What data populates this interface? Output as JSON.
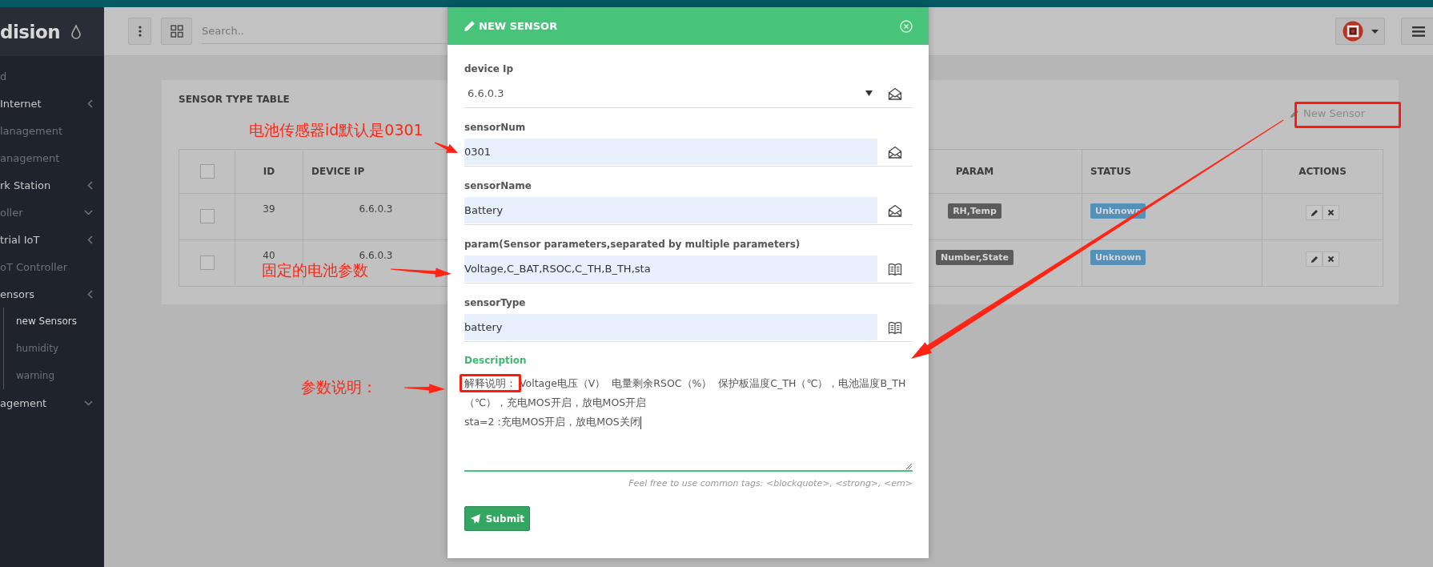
{
  "sidebar": {
    "brand": "dision",
    "items": [
      {
        "label": "d",
        "kind": "link"
      },
      {
        "label": "Internet",
        "kind": "heading",
        "expanded": false
      },
      {
        "label": "lanagement",
        "kind": "link"
      },
      {
        "label": "anagement",
        "kind": "link"
      },
      {
        "label": "rk Station",
        "kind": "heading",
        "expanded": false
      },
      {
        "label": "oller",
        "kind": "link",
        "expanded": true
      },
      {
        "label": "trial IoT",
        "kind": "heading",
        "expanded": false
      },
      {
        "label": "oT Controller",
        "kind": "link"
      },
      {
        "label": "ensors",
        "kind": "heading",
        "expanded": false,
        "children": [
          {
            "label": "new Sensors",
            "selected": true
          },
          {
            "label": "humidity",
            "selected": false
          },
          {
            "label": "warning",
            "selected": false
          }
        ]
      },
      {
        "label": "agement",
        "kind": "heading",
        "expanded": true
      }
    ]
  },
  "header": {
    "search": {
      "placeholder": "Search.."
    }
  },
  "panel": {
    "title": "SENSOR TYPE TABLE",
    "new_button": "New Sensor",
    "table": {
      "columns": [
        "ID",
        "DEVICE IP",
        "PARAM",
        "STATUS",
        "ACTIONS"
      ],
      "select_all_checked": false,
      "rows": [
        {
          "checked": false,
          "id": "39",
          "device_ip": "6.6.0.3",
          "param": "RH,Temp",
          "status": "Unknown"
        },
        {
          "checked": false,
          "id": "40",
          "device_ip": "6.6.0.3",
          "param": "Number,State",
          "status": "Unknown"
        }
      ]
    }
  },
  "modal": {
    "title": "NEW SENSOR",
    "fields": [
      {
        "label": "device Ip",
        "kind": "select",
        "value": "6.6.0.3"
      },
      {
        "label": "sensorNum",
        "kind": "text",
        "value": "0301"
      },
      {
        "label": "sensorName",
        "kind": "text",
        "value": "Battery"
      },
      {
        "label": "param(Sensor parameters,separated by multiple parameters)",
        "kind": "text",
        "value": "Voltage,C_BAT,RSOC,C_TH,B_TH,sta"
      },
      {
        "label": "sensorType",
        "kind": "text",
        "value": "battery"
      }
    ],
    "description": {
      "label": "Description",
      "value": "解释说明： Voltage电压（V）  电量剩余RSOC（%）  保护板温度C_TH（℃），电池温度B_TH（℃），充电MOS开启，放电MOS开启\nsta=2 :充电MOS开启，放电MOS关闭",
      "help": "Feel free to use common tags: <blockquote>, <strong>, <em>"
    },
    "submit": "Submit"
  },
  "annotations": [
    {
      "kind": "note",
      "text": "电池传感器id默认是0301"
    },
    {
      "kind": "note",
      "text": "固定的电池参数"
    },
    {
      "kind": "note",
      "text": "参数说明："
    }
  ]
}
